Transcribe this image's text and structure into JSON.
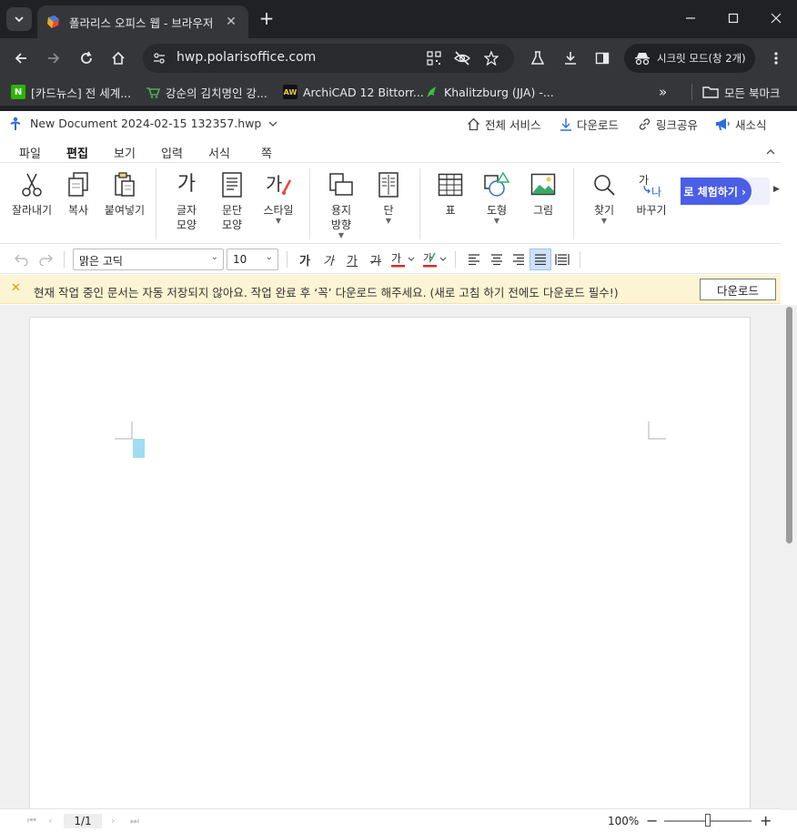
{
  "browser": {
    "tab": {
      "title": "폴라리스 오피스 웹 - 브라우저",
      "close": "✕"
    },
    "new_tab": "+",
    "url": "hwp.polarisoffice.com",
    "incognito_label": "시크릿 모드(창 2개)",
    "bookmarks": [
      {
        "label": "[카드뉴스] 전 세계...",
        "icon": "N",
        "color": "#2db400"
      },
      {
        "label": "강순의 김치명인 강...",
        "icon": "cart",
        "color": "#4caf50"
      },
      {
        "label": "ArchiCAD 12 Bittorr...",
        "icon": "AW",
        "color": "#1a1a1a"
      },
      {
        "label": "Khalitzburg (JJA) -...",
        "icon": "leaf",
        "color": "#3cc13c"
      }
    ],
    "bookmarks_overflow": "»",
    "all_bookmarks": "모든 북마크"
  },
  "app": {
    "doc_title": "New Document 2024-02-15 132357.hwp",
    "top_actions": {
      "all_services": "전체 서비스",
      "download": "다운로드",
      "share_link": "링크공유",
      "news": "새소식"
    },
    "menu_tabs": [
      "파일",
      "편집",
      "보기",
      "입력",
      "서식",
      "쪽"
    ],
    "active_tab": "편집",
    "ribbon": {
      "cut": "잘라내기",
      "copy": "복사",
      "paste": "붙여넣기",
      "char_shape_1": "글자",
      "char_shape_2": "모양",
      "para_shape_1": "문단",
      "para_shape_2": "모양",
      "style": "스타일",
      "paper_dir_1": "용지",
      "paper_dir_2": "방향",
      "columns": "단",
      "table": "표",
      "shape": "도형",
      "picture": "그림",
      "find": "찾기",
      "replace": "바꾸기",
      "promo": "로 체험하기 ›"
    },
    "format": {
      "font": "맑은 고딕",
      "size": "10",
      "glyph_ga": "가"
    },
    "notice": {
      "text": "현재 작업 중인 문서는 자동 저장되지 않아요. 작업 완료 후 ‘꼭’ 다운로드 해주세요. (새로 고침 하기 전에도 다운로드 필수!)",
      "button": "다운로드"
    },
    "status": {
      "page_indicator": "1/1",
      "zoom": "100%"
    }
  }
}
